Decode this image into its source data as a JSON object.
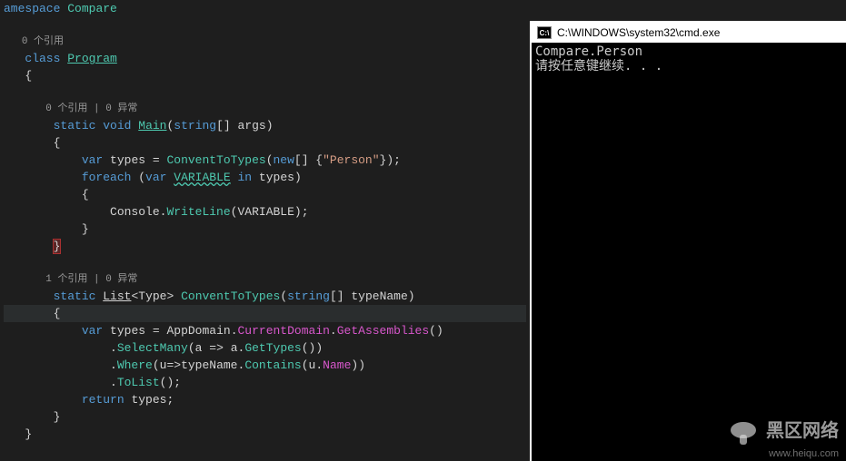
{
  "editor": {
    "ns_line_prefix": "amespace",
    "ns_name": "Compare",
    "codelens1": "0 个引用",
    "kw_class": "class",
    "classname": "Program",
    "codelens2": "0 个引用 | 0 异常",
    "kw_static": "static",
    "kw_void": "void",
    "main_name": "Main",
    "kw_string_arr": "string",
    "brackets": "[]",
    "param_args": "args",
    "kw_var": "var",
    "var_types": "types",
    "eq": " = ",
    "method_convent": "ConventToTypes",
    "kw_new": "new",
    "str_person": "\"Person\"",
    "kw_foreach": "foreach",
    "kw_var2": "var",
    "var_VARIABLE": "VARIABLE",
    "kw_in": "in",
    "var_types2": "types",
    "cls_console": "Console",
    "method_writeline": "WriteLine",
    "arg_VARIABLE": "VARIABLE",
    "codelens3": "1 个引用 | 0 异常",
    "cls_list": "List",
    "cls_type": "Type",
    "method_convent2": "ConventToTypes",
    "param_typename": "typeName",
    "cls_appdomain": "AppDomain",
    "prop_currentdomain": "CurrentDomain",
    "method_getassemblies": "GetAssemblies",
    "method_selectmany": "SelectMany",
    "lambda_a": "a",
    "arrow": " => ",
    "method_gettypes": "GetTypes",
    "method_where": "Where",
    "lambda_u": "u",
    "arrow2": "=>",
    "method_contains": "Contains",
    "prop_name": "Name",
    "method_tolist": "ToList",
    "kw_return": "return",
    "ret_types": "types"
  },
  "cmd": {
    "title": "C:\\WINDOWS\\system32\\cmd.exe",
    "icon_label": "C:\\",
    "out1": "Compare.Person",
    "out2": "请按任意键继续. . ."
  },
  "watermark": {
    "title": "黑区网络",
    "url": "www.heiqu.com"
  }
}
